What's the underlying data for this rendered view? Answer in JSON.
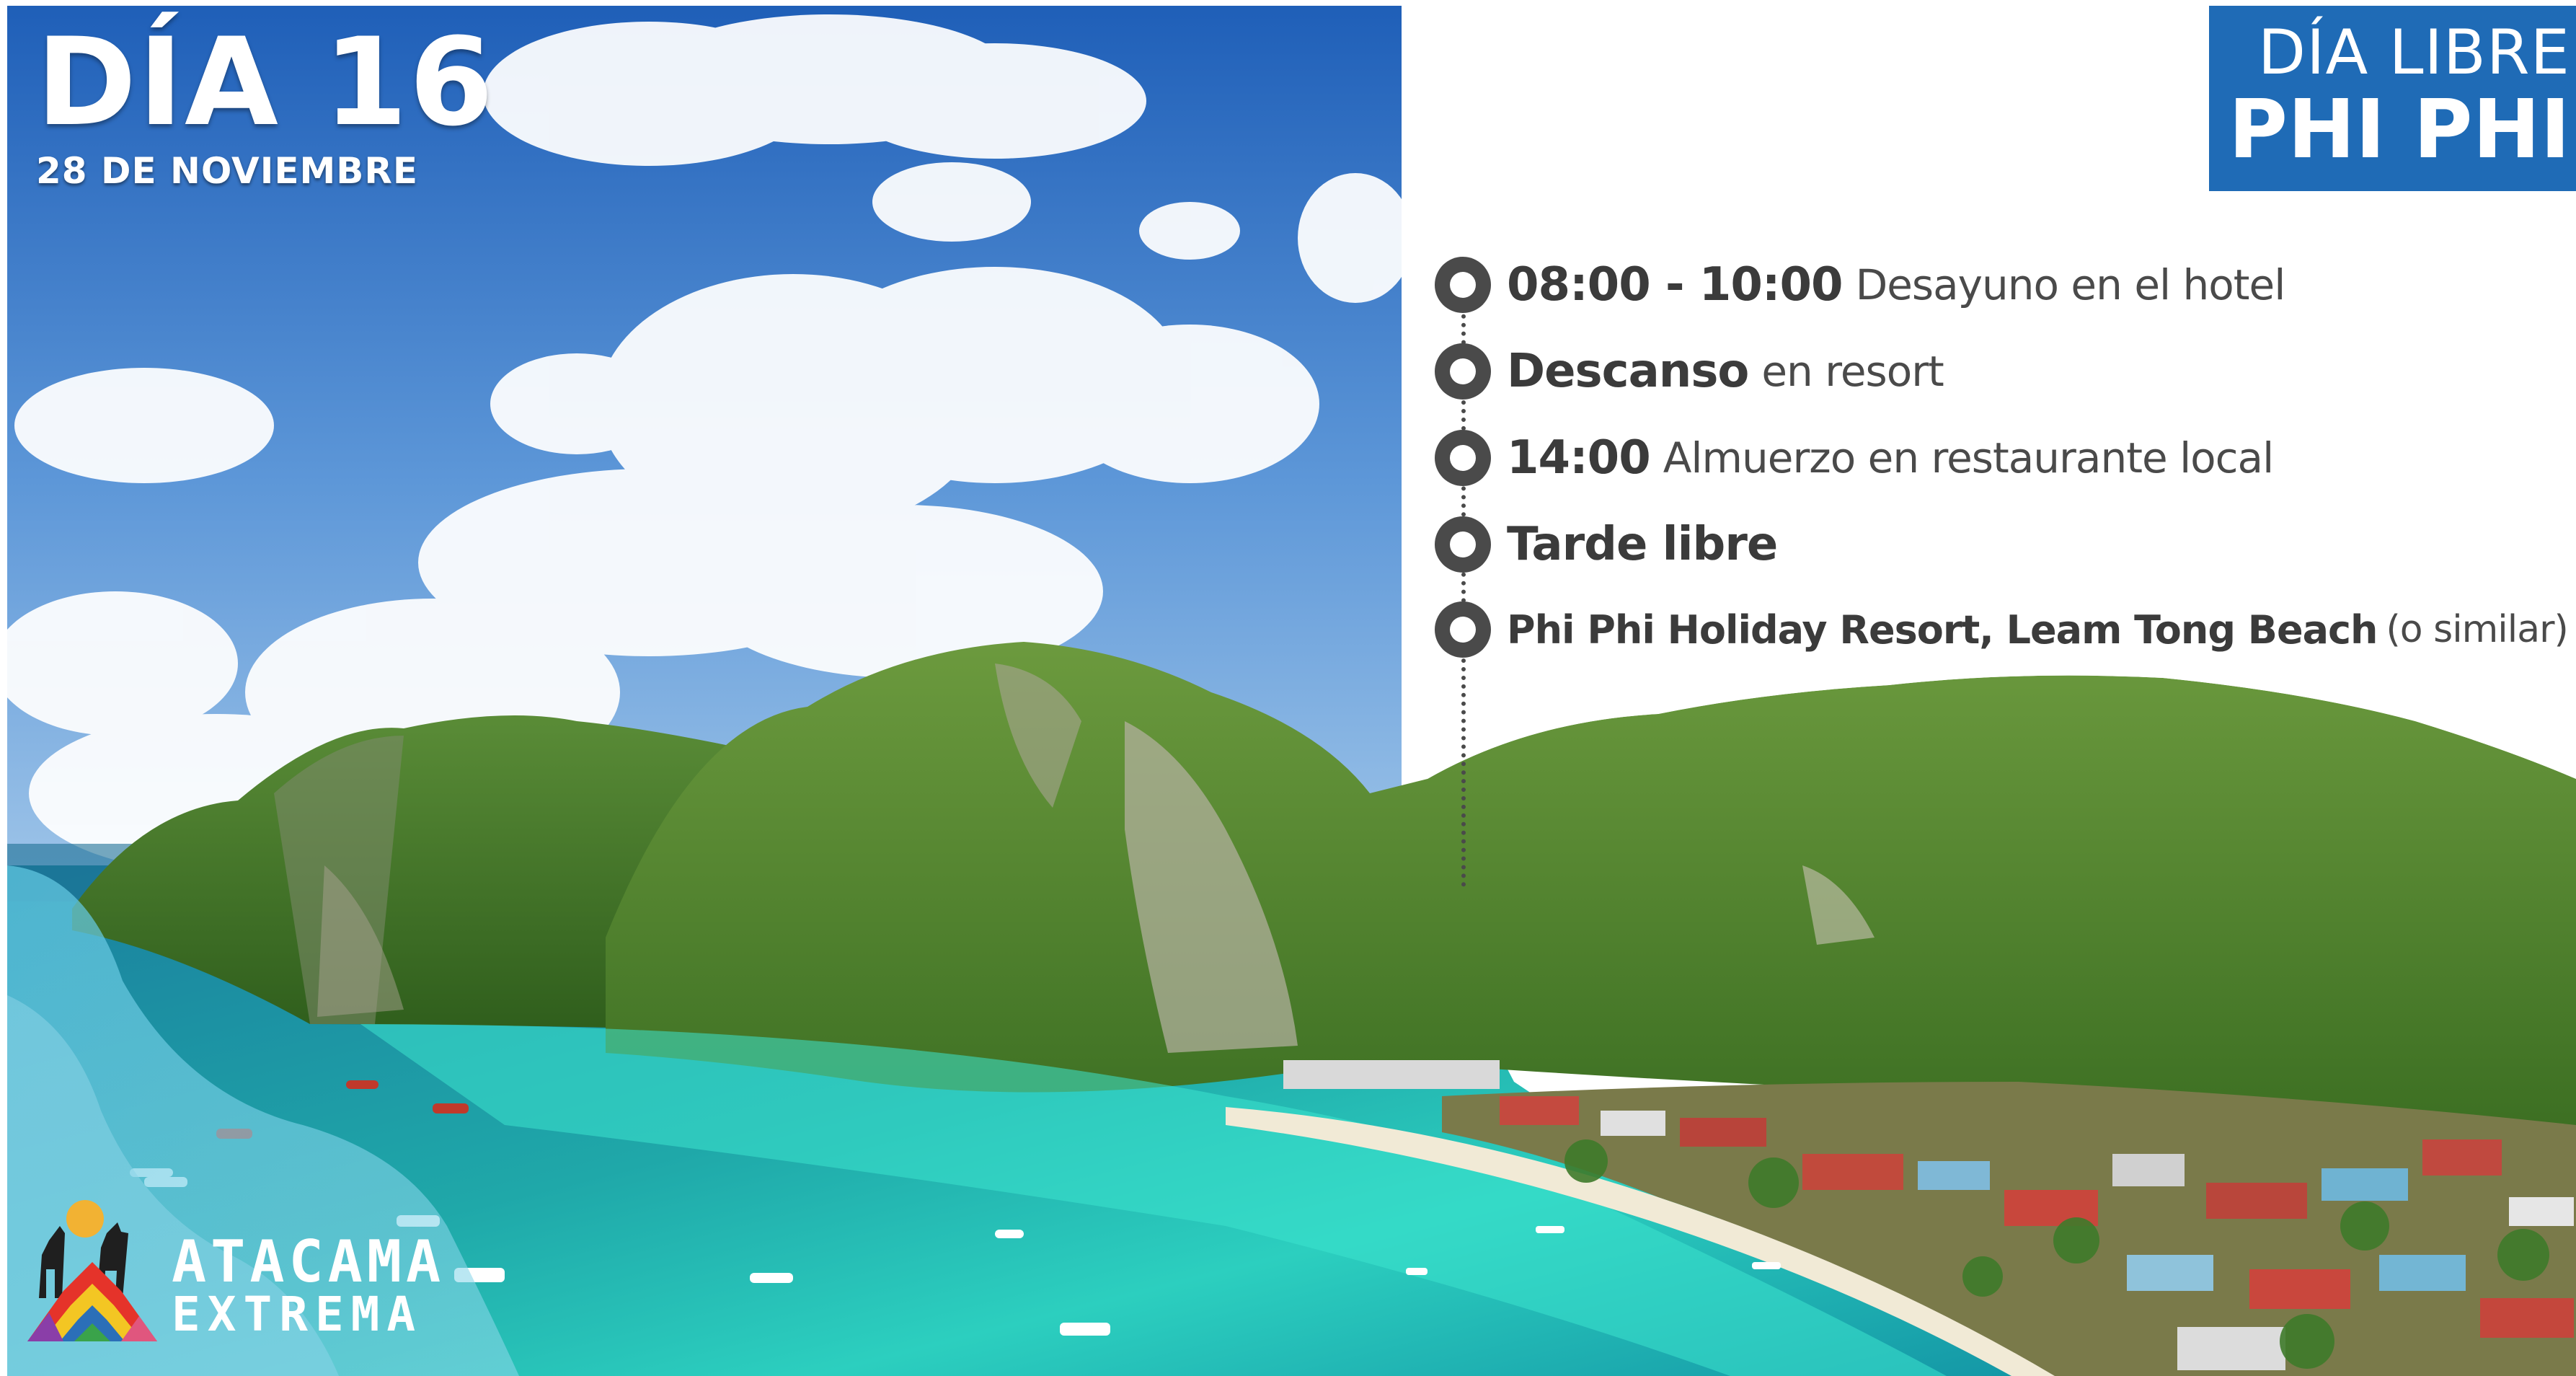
{
  "day": {
    "title": "DÍA 16",
    "date": "28 DE NOVIEMBRE"
  },
  "badge": {
    "line1": "DÍA LIBRE",
    "line2": "PHI PHI",
    "color": "#1f6bb6"
  },
  "itinerary": [
    {
      "bold": "08:00 - 10:00",
      "light": "Desayuno en el hotel"
    },
    {
      "bold": "Descanso",
      "light": "en resort"
    },
    {
      "bold": "14:00",
      "light": "Almuerzo en restaurante local"
    },
    {
      "bold": "Tarde libre",
      "light": ""
    },
    {
      "bold": "Phi Phi Holiday Resort, Leam Tong Beach",
      "light": "(o similar)"
    }
  ],
  "logo": {
    "line1": "ATACAMA",
    "line2": "EXTREMA"
  },
  "icons": [
    "timeline-dot-icon",
    "atacama-extrema-logo-icon"
  ],
  "colors": {
    "sky": "#2f76c9",
    "sea": "#19b3b0",
    "jungle": "#3f7a25",
    "text_dark": "#3b3b3b"
  }
}
